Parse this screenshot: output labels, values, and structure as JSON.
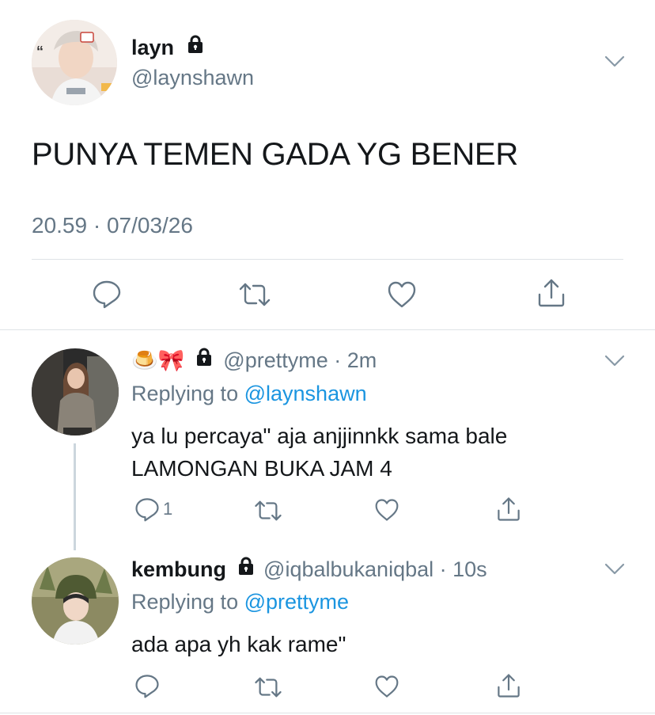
{
  "main_tweet": {
    "display_name": "layn",
    "handle": "@laynshawn",
    "text": "PUNYA TEMEN GADA YG BENER",
    "timestamp": "20.59 · 07/03/26",
    "protected": true,
    "actions": [
      "reply-icon",
      "retweet-icon",
      "like-icon",
      "share-icon"
    ]
  },
  "replies": [
    {
      "display_name": "🍮🎀",
      "handle": "@prettyme",
      "time": "· 2m",
      "protected": true,
      "replying_label": "Replying to",
      "replying_to": "@laynshawn",
      "text_line1": "ya lu percaya\" aja anjjinnkk sama bale",
      "text_line2": "LAMONGAN BUKA JAM 4",
      "reply_count": "1"
    },
    {
      "display_name": "kembung",
      "handle": "@iqbalbukaniqbal",
      "time": "· 10s",
      "protected": true,
      "replying_label": "Replying to",
      "replying_to": "@prettyme",
      "text_line1": "ada apa yh kak rame\"",
      "reply_count": ""
    }
  ],
  "colors": {
    "text": "#14171a",
    "muted": "#657786",
    "link": "#1b95e0",
    "divider": "#dfe3e6",
    "thread_line": "#ccd6dd"
  }
}
